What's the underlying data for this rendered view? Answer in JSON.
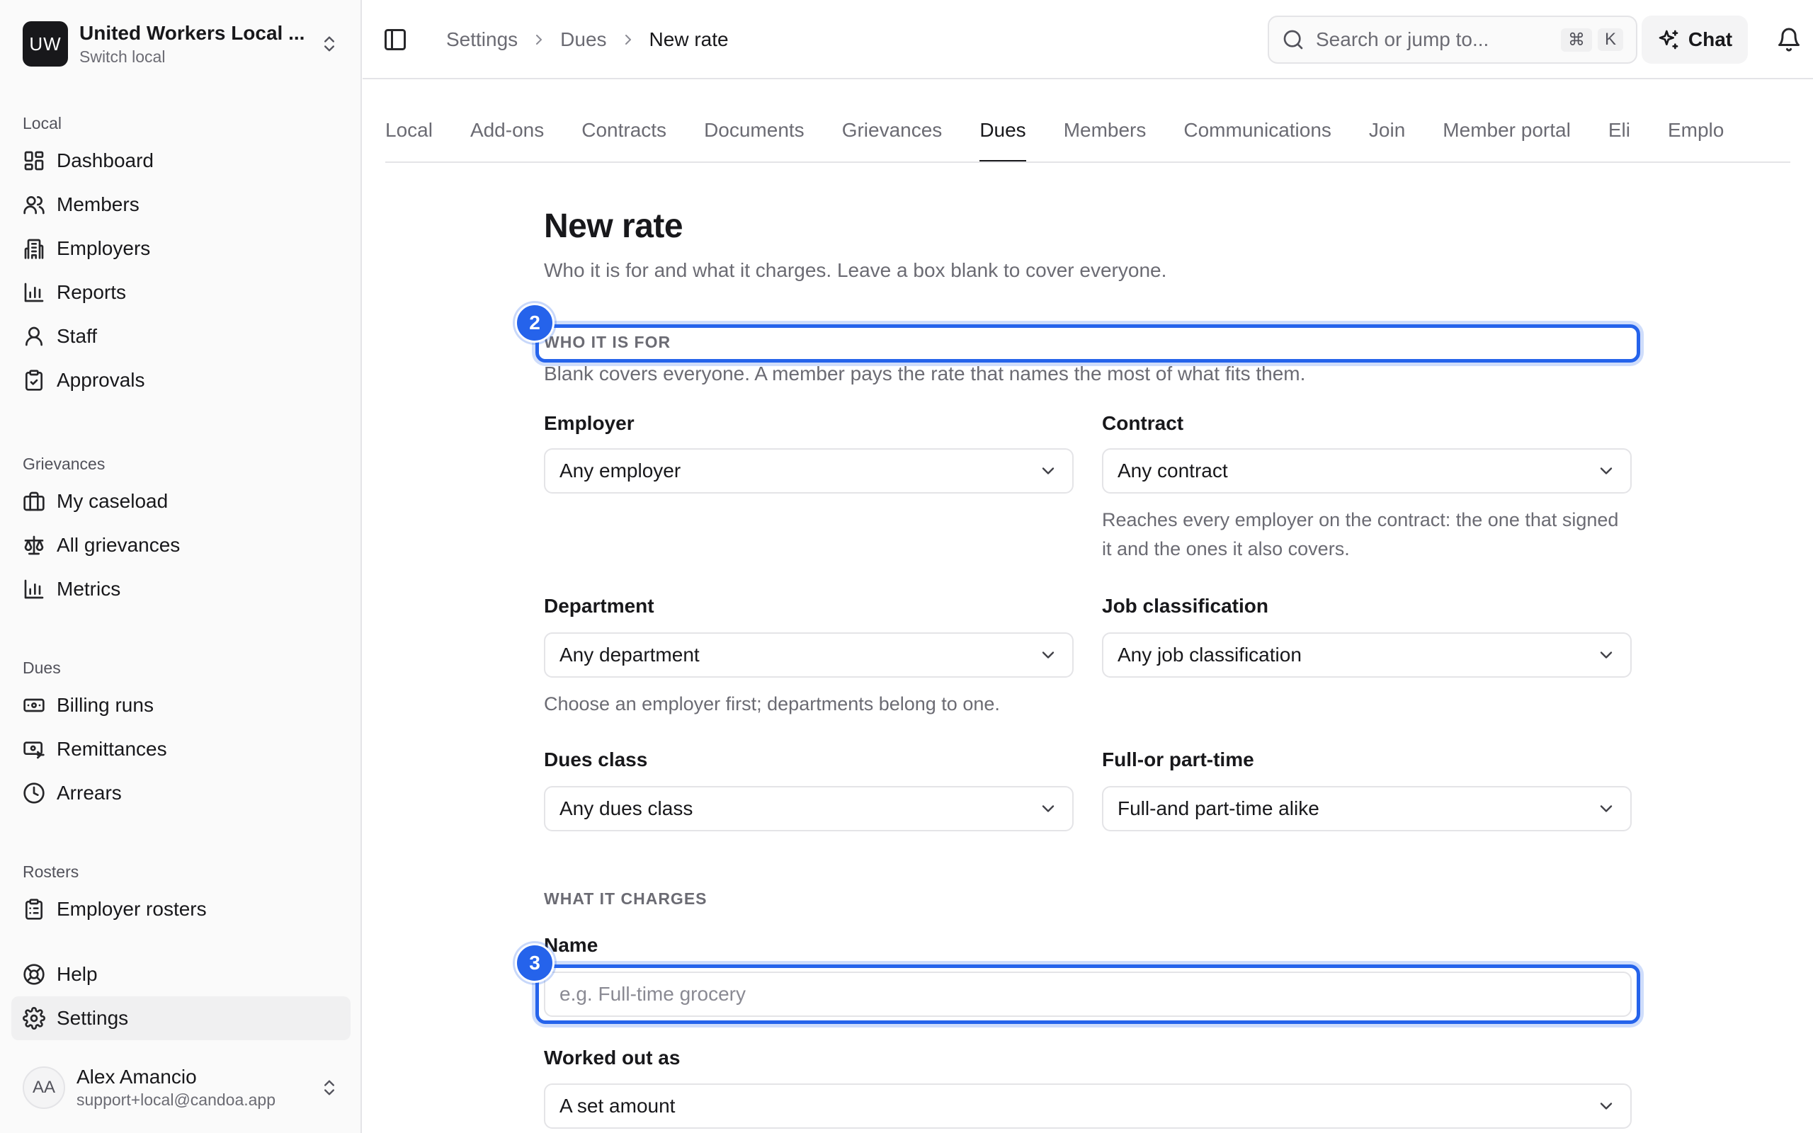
{
  "org": {
    "initials": "UW",
    "name": "United Workers Local ...",
    "sub": "Switch local"
  },
  "sidebar": {
    "local": {
      "heading": "Local",
      "items": [
        {
          "label": "Dashboard",
          "icon": "dashboard-icon"
        },
        {
          "label": "Members",
          "icon": "users-icon"
        },
        {
          "label": "Employers",
          "icon": "building-icon"
        },
        {
          "label": "Reports",
          "icon": "bar-chart-icon"
        },
        {
          "label": "Staff",
          "icon": "user-icon"
        },
        {
          "label": "Approvals",
          "icon": "clipboard-check-icon"
        }
      ]
    },
    "grievances": {
      "heading": "Grievances",
      "items": [
        {
          "label": "My caseload",
          "icon": "briefcase-icon"
        },
        {
          "label": "All grievances",
          "icon": "scale-icon"
        },
        {
          "label": "Metrics",
          "icon": "bar-chart-icon"
        }
      ]
    },
    "dues": {
      "heading": "Dues",
      "items": [
        {
          "label": "Billing runs",
          "icon": "banknote-icon"
        },
        {
          "label": "Remittances",
          "icon": "money-transfer-icon"
        },
        {
          "label": "Arrears",
          "icon": "clock-icon"
        }
      ]
    },
    "rosters": {
      "heading": "Rosters",
      "items": [
        {
          "label": "Employer rosters",
          "icon": "clipboard-list-icon"
        }
      ]
    },
    "help": "Help",
    "settings": "Settings"
  },
  "user": {
    "initials": "AA",
    "name": "Alex Amancio",
    "email": "support+local@candoa.app"
  },
  "topbar": {
    "breadcrumb": [
      "Settings",
      "Dues"
    ],
    "current": "New rate",
    "search_placeholder": "Search or jump to...",
    "kbd_cmd": "⌘",
    "kbd_key": "K",
    "chat": "Chat"
  },
  "tabs": [
    "Local",
    "Add-ons",
    "Contracts",
    "Documents",
    "Grievances",
    "Dues",
    "Members",
    "Communications",
    "Join",
    "Member portal",
    "Eli",
    "Emplo"
  ],
  "active_tab": "Dues",
  "form": {
    "title": "New rate",
    "subtitle": "Who it is for and what it charges. Leave a box blank to cover everyone.",
    "who": {
      "heading": "WHO IT IS FOR",
      "desc": "Blank covers everyone. A member pays the rate that names the most of what fits them."
    },
    "employer": {
      "label": "Employer",
      "value": "Any employer"
    },
    "contract": {
      "label": "Contract",
      "value": "Any contract",
      "help": "Reaches every employer on the contract: the one that signed it and the ones it also covers."
    },
    "department": {
      "label": "Department",
      "value": "Any department",
      "help": "Choose an employer first; departments belong to one."
    },
    "job_classification": {
      "label": "Job classification",
      "value": "Any job classification"
    },
    "dues_class": {
      "label": "Dues class",
      "value": "Any dues class"
    },
    "employment_type": {
      "label": "Full-or part-time",
      "value": "Full-and part-time alike"
    },
    "charges": {
      "heading": "WHAT IT CHARGES"
    },
    "name": {
      "label": "Name",
      "placeholder": "e.g. Full-time grocery",
      "value": ""
    },
    "worked_out_as": {
      "label": "Worked out as",
      "value": "A set amount"
    }
  },
  "markers": [
    "2",
    "3"
  ],
  "colors": {
    "accent": "#2563eb",
    "text": "#18181b",
    "muted": "#6b6b73",
    "border": "#e4e4e7"
  }
}
